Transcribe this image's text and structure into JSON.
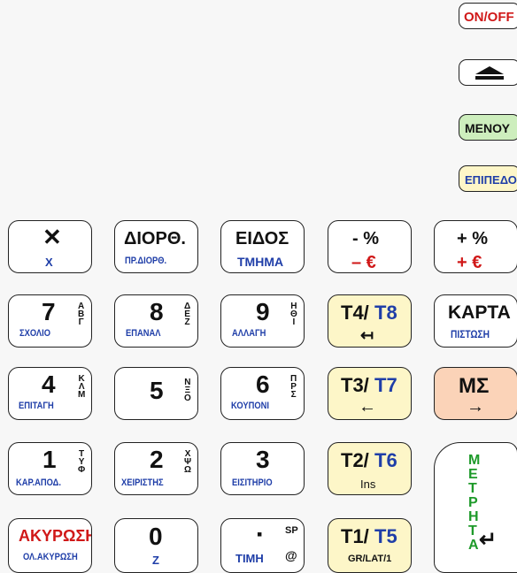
{
  "top": {
    "on_off": "ON/OFF",
    "menu": "ΜΕΝΟΥ",
    "epipedo": "ΕΠΙΠΕΔΟ"
  },
  "keys": {
    "x": {
      "main": "✕",
      "sub": "X"
    },
    "diortho": {
      "main": "ΔΙΟΡΘ.",
      "sub": "ΠΡ.ΔΙΟΡΘ."
    },
    "eidos": {
      "main": "ΕΙΔΟΣ",
      "sub": "ΤΜΗΜΑ"
    },
    "minus": {
      "main": "- %",
      "sub": "– €"
    },
    "plus": {
      "main": "+ %",
      "sub": "+ €"
    },
    "k7": {
      "main": "7",
      "sub": "ΣΧΟΛΙΟ",
      "side": "Α\nΒ\nΓ"
    },
    "k8": {
      "main": "8",
      "sub": "ΕΠΑΝΑΛ",
      "side": "Δ\nΕ\nΖ"
    },
    "k9": {
      "main": "9",
      "sub": "ΑΛΛΑΓΗ",
      "side": "Η\nΘ\nΙ"
    },
    "t4t8": {
      "a": "T4/",
      "b": "T8",
      "arrow": "↤"
    },
    "karta": {
      "main": "ΚΑΡΤΑ",
      "sub": "ΠΙΣΤΩΣΗ"
    },
    "k4": {
      "main": "4",
      "sub": "ΕΠΙΤΑΓΗ",
      "side": "Κ\nΛ\nΜ"
    },
    "k5": {
      "main": "5",
      "side": "Ν\nΞ\nΟ"
    },
    "k6": {
      "main": "6",
      "sub": "ΚΟΥΠΟΝΙ",
      "side": "Π\nΡ\nΣ"
    },
    "t3t7": {
      "a": "T3/",
      "b": "T7",
      "arrow": "←"
    },
    "ms": {
      "main": "ΜΣ",
      "arrow": "→"
    },
    "k1": {
      "main": "1",
      "sub": "ΚΑΡ.ΑΠΟΔ.",
      "side": "Τ\nΥ\nΦ"
    },
    "k2": {
      "main": "2",
      "sub": "ΧΕΙΡΙΣΤΗΣ",
      "side": "Χ\nΨ\nΩ"
    },
    "k3": {
      "main": "3",
      "sub": "ΕΙΣΙΤΗΡΙΟ"
    },
    "t2t6": {
      "a": "T2/",
      "b": "T6",
      "small": "Ins"
    },
    "metrita": {
      "letters": "Μ\nΕ\nΤ\nΡ\nΗ\nΤ\nΑ",
      "arrow": "↵"
    },
    "akyrosi": {
      "main": "ΑΚΥΡΩΣΗ",
      "sub": "ΟΛ.ΑΚΥΡΩΣΗ"
    },
    "k0": {
      "main": "0",
      "sub": "Z"
    },
    "dot": {
      "main": "▪",
      "sub": "ΤΙΜΗ",
      "sp": "SP",
      "at": "@"
    },
    "t1t5": {
      "a": "T1/",
      "b": "T5",
      "small": "GR/LAT/1"
    }
  }
}
